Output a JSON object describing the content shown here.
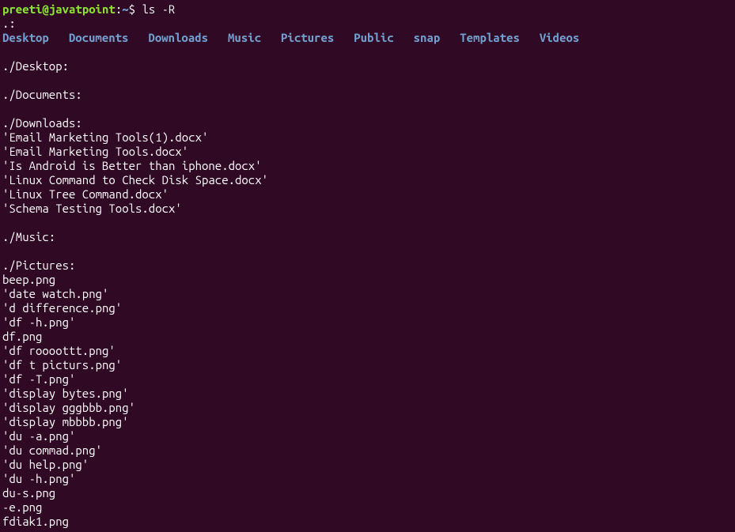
{
  "prompt": {
    "user": "preeti",
    "at": "@",
    "host": "javatpoint",
    "colon": ":",
    "path": "~",
    "dollar": "$"
  },
  "command": "ls -R",
  "sections": {
    "root_header": ".:",
    "root_dirs": [
      "Desktop",
      "Documents",
      "Downloads",
      "Music",
      "Pictures",
      "Public",
      "snap",
      "Templates",
      "Videos"
    ],
    "desktop_header": "./Desktop:",
    "documents_header": "./Documents:",
    "downloads_header": "./Downloads:",
    "downloads_files": [
      "'Email Marketing Tools(1).docx'",
      "'Email Marketing Tools.docx'",
      "'Is Android is Better than iphone.docx'",
      "'Linux Command to Check Disk Space.docx'",
      "'Linux Tree Command.docx'",
      "'Schema Testing Tools.docx'"
    ],
    "music_header": "./Music:",
    "pictures_header": "./Pictures:",
    "pictures_files": [
      " beep.png",
      "'date watch.png'",
      "'d difference.png'",
      "'df -h.png'",
      " df.png",
      "'df roooottt.png'",
      "'df t picturs.png'",
      "'df -T.png'",
      "'display bytes.png'",
      "'display gggbbb.png'",
      "'display mbbbb.png'",
      "'du -a.png'",
      "'du commad.png'",
      "'du help.png'",
      "'du -h.png'",
      " du-s.png",
      " -e.png",
      " fdiak1.png"
    ]
  }
}
